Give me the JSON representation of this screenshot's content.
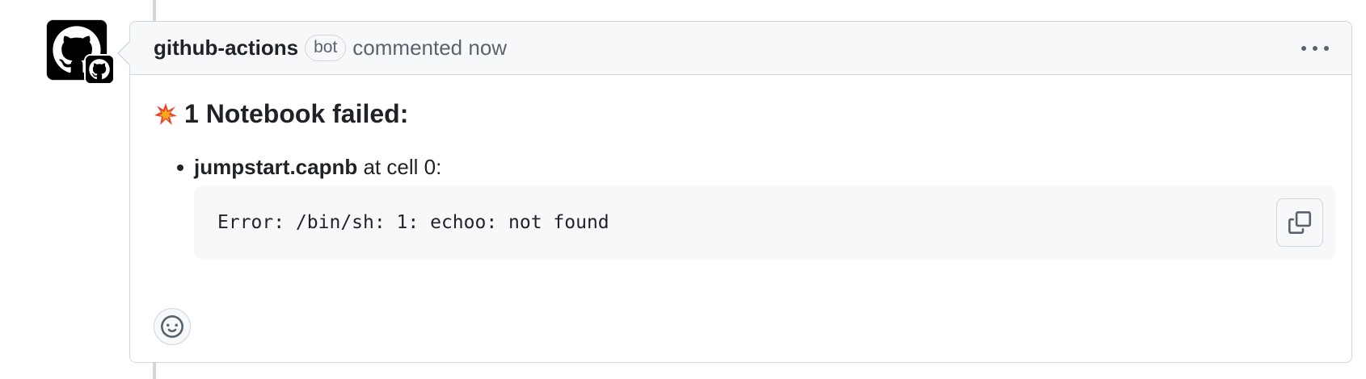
{
  "comment": {
    "author": "github-actions",
    "badge": "bot",
    "header_text": "commented now",
    "options_icon": "kebab-horizontal-icon"
  },
  "body": {
    "heading_icon": "collision-emoji",
    "heading_text": "1 Notebook failed:",
    "items": [
      {
        "filename": "jumpstart.capnb",
        "suffix": " at cell 0:",
        "code": "Error: /bin/sh: 1: echoo: not found",
        "copy_icon": "copy-icon"
      }
    ]
  },
  "reactions": {
    "add_icon": "smiley-icon"
  },
  "colors": {
    "border": "#d0d7de",
    "header_bg": "#f6f8fa",
    "text": "#1f2328",
    "muted": "#59636e"
  }
}
